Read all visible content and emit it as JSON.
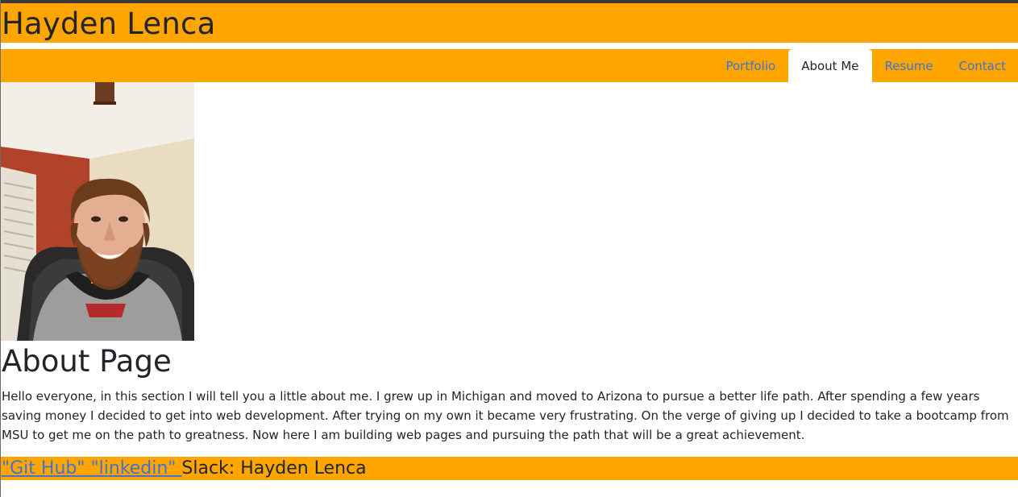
{
  "header": {
    "title": "Hayden Lenca"
  },
  "nav": {
    "items": [
      {
        "label": "Portfolio",
        "active": false
      },
      {
        "label": "About Me",
        "active": true
      },
      {
        "label": "Resume",
        "active": false
      },
      {
        "label": "Contact",
        "active": false
      }
    ]
  },
  "main": {
    "heading": "About Page",
    "paragraph": "Hello everyone, in this section I will tell you a little about me. I grew up in Michigan and moved to Arizona to pursue a better life path. After spending a few years saving money I decided to get into web development. After trying on my own it became very frustrating. On the verge of giving up I decided to take a bootcamp from MSU to get me on the path to greatness. Now here I am building web pages and pursuing the path that will be a great achievement."
  },
  "footer": {
    "github_label": "\"Git Hub\"",
    "linkedin_label": "\"linkedin\"",
    "slack_label": "Slack: Hayden Lenca"
  },
  "colors": {
    "accent": "#ffa500",
    "link": "#3f72d6",
    "text": "#212529"
  }
}
